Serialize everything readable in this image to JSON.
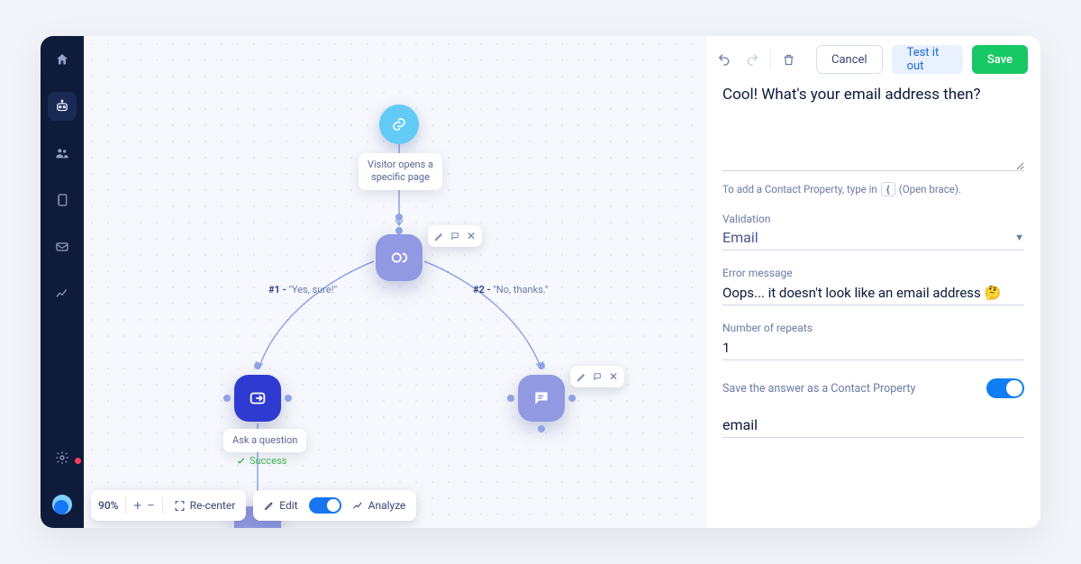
{
  "canvas": {
    "trigger_label": "Visitor opens a\nspecific page",
    "branch1_num": "#1 - ",
    "branch1_text": "\"Yes, sure!\"",
    "branch2_num": "#2 - ",
    "branch2_text": "\"No, thanks.\"",
    "ask_label": "Ask a question",
    "success_label": "Success"
  },
  "toolbar": {
    "zoom": "90%",
    "recenter": "Re-center",
    "edit": "Edit",
    "analyze": "Analyze"
  },
  "panel": {
    "cancel": "Cancel",
    "test": "Test it out",
    "save": "Save",
    "message": "Cool! What's your email address then?",
    "hint_prefix": "To add a Contact Property, type in",
    "hint_suffix": "(Open brace).",
    "validation_label": "Validation",
    "validation_value": "Email",
    "error_label": "Error message",
    "error_value": "Oops... it doesn't look like an email address 🤔",
    "repeats_label": "Number of repeats",
    "repeats_value": "1",
    "save_prop_label": "Save the answer as a Contact Property",
    "property_value": "email"
  }
}
